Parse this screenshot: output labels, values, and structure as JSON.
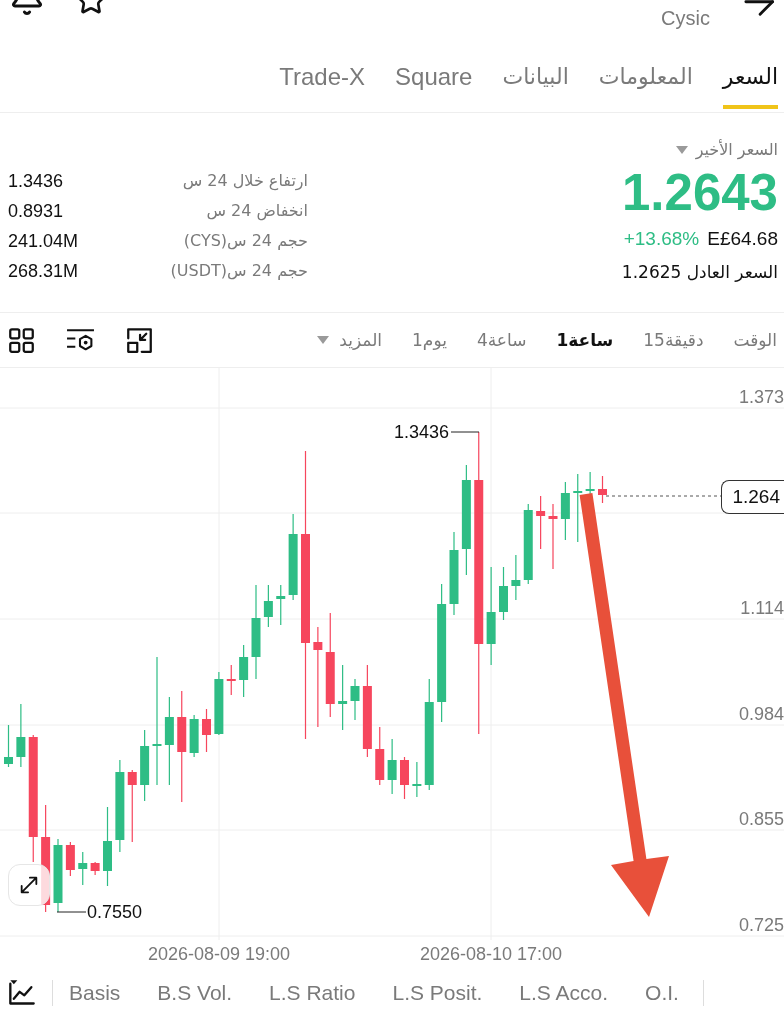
{
  "header": {
    "title": "Cysic"
  },
  "tabs": [
    {
      "label": "السعر",
      "selected": true
    },
    {
      "label": "المعلومات",
      "selected": false
    },
    {
      "label": "البيانات",
      "selected": false
    },
    {
      "label": "Square",
      "selected": false
    },
    {
      "label": "Trade-X",
      "selected": false
    }
  ],
  "price": {
    "label": "السعر الأخير",
    "last_price": "1.2643",
    "change": "+13.68%",
    "local_price": "E£64.68",
    "fair_price": "السعر العادل 1.2625"
  },
  "stats": [
    {
      "label": "ارتفاع خلال 24 س",
      "value": "1.3436"
    },
    {
      "label": "انخفاض 24 س",
      "value": "0.8931"
    },
    {
      "label": "حجم 24 س(CYS)",
      "value": "241.04M"
    },
    {
      "label": "حجم 24 س(USDT)",
      "value": "268.31M"
    }
  ],
  "intervals": [
    {
      "label": "الوقت",
      "kind": "option",
      "selected": false
    },
    {
      "label": "15دقيقة",
      "kind": "option",
      "selected": false
    },
    {
      "label": "1ساعة",
      "kind": "option",
      "selected": true
    },
    {
      "label": "4ساعة",
      "kind": "option",
      "selected": false
    },
    {
      "label": "1يوم",
      "kind": "option",
      "selected": false
    },
    {
      "label": "المزيد",
      "kind": "dropdown",
      "selected": false
    }
  ],
  "chart": {
    "y_labels": [
      "1.373",
      "1.114",
      "0.984",
      "0.855",
      "0.725"
    ],
    "x_labels": [
      "2026-08-10 17:00",
      "2026-08-09 19:00"
    ],
    "high_label": "1.3436",
    "low_label": "0.7550",
    "current_price": "1.264"
  },
  "indicators": [
    "O.I.",
    "L.S Acco.",
    "L.S Posit.",
    "L.S Ratio",
    "B.S Vol.",
    "Basis"
  ]
}
